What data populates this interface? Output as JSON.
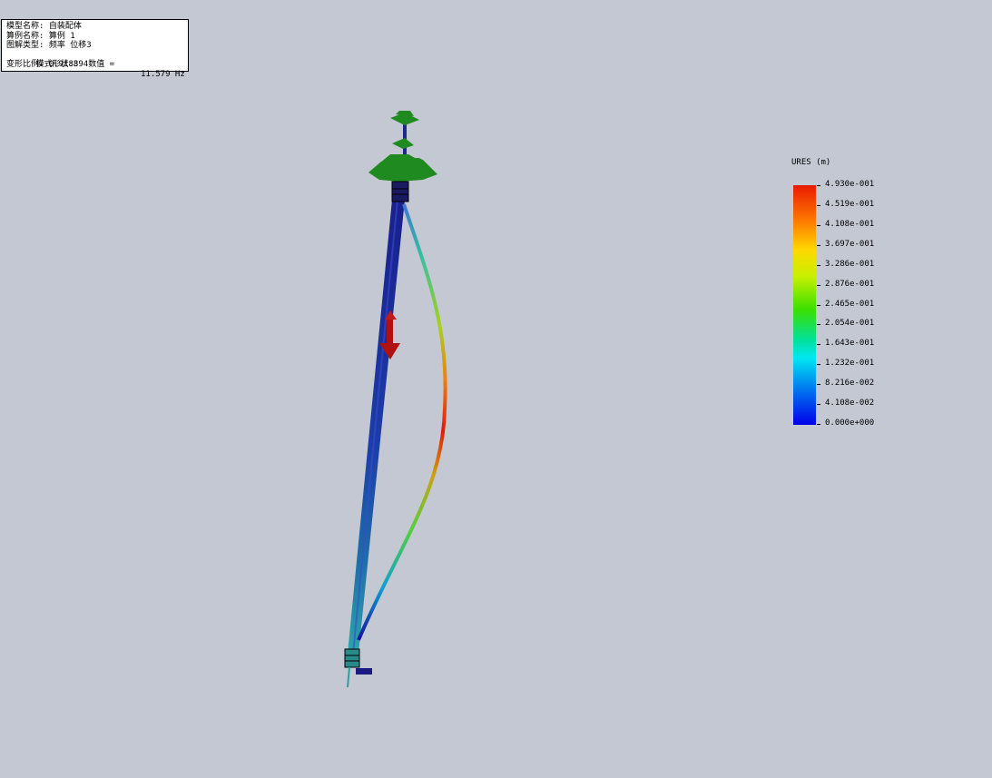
{
  "info_box": {
    "model_name": "模型名称: 自装配体",
    "study_name": "算例名称: 算例 1",
    "plot_type": "图解类型: 频率 位移3",
    "mode_shape": "模式形状:3  数值 =",
    "frequency": "11.579 Hz",
    "deform_scale": "变形比例: 0.918894"
  },
  "legend": {
    "title": "URES (m)",
    "labels": [
      "4.930e-001",
      "4.519e-001",
      "4.108e-001",
      "3.697e-001",
      "3.286e-001",
      "2.876e-001",
      "2.465e-001",
      "2.054e-001",
      "1.643e-001",
      "1.232e-001",
      "8.216e-002",
      "4.108e-002",
      "0.000e+000"
    ],
    "color_max": "#e81b00",
    "color_min": "#0000e8"
  },
  "colors": {
    "background": "#c4c8d2",
    "fixture_green": "#1f8a1f",
    "load_arrow": "#b01010",
    "tube_blue": "#1a2a9a"
  }
}
